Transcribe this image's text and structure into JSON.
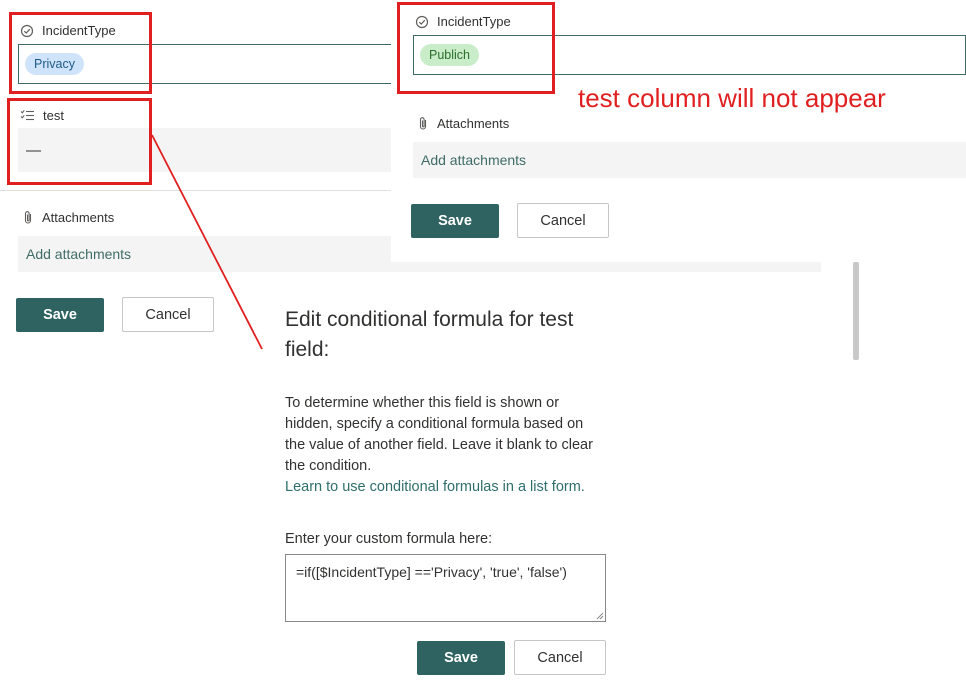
{
  "left_form": {
    "incident_type": {
      "label": "IncidentType",
      "value": "Privacy"
    },
    "test": {
      "label": "test",
      "value": "—"
    },
    "attachments": {
      "label": "Attachments",
      "add_text": "Add attachments"
    },
    "save_label": "Save",
    "cancel_label": "Cancel"
  },
  "right_form": {
    "incident_type": {
      "label": "IncidentType",
      "value": "Publich"
    },
    "attachments": {
      "label": "Attachments",
      "add_text": "Add attachments"
    },
    "save_label": "Save",
    "cancel_label": "Cancel"
  },
  "annotation": {
    "text": "test column will not appear",
    "color": "#e02020"
  },
  "dialog": {
    "title": "Edit conditional formula for test field:",
    "description": "To determine whether this field is shown or hidden, specify a conditional formula based on the value of another field. Leave it blank to clear the condition.",
    "link_text": "Learn to use conditional formulas in a list form.",
    "formula_label": "Enter your custom formula here:",
    "formula_value": "=if([$IncidentType] =='Privacy', 'true', 'false')",
    "save_label": "Save",
    "cancel_label": "Cancel"
  },
  "colors": {
    "primary_button": "#2f6361",
    "focus_border": "#3f6b66",
    "pill_blue": "#cfe4fa",
    "pill_green": "#c9ecc9",
    "annotation_red": "#e02020",
    "link": "#2f6e6b"
  },
  "icons": {
    "choice_field": "circle-check-icon",
    "multiline_field": "checklist-icon",
    "attachment": "paperclip-icon"
  }
}
